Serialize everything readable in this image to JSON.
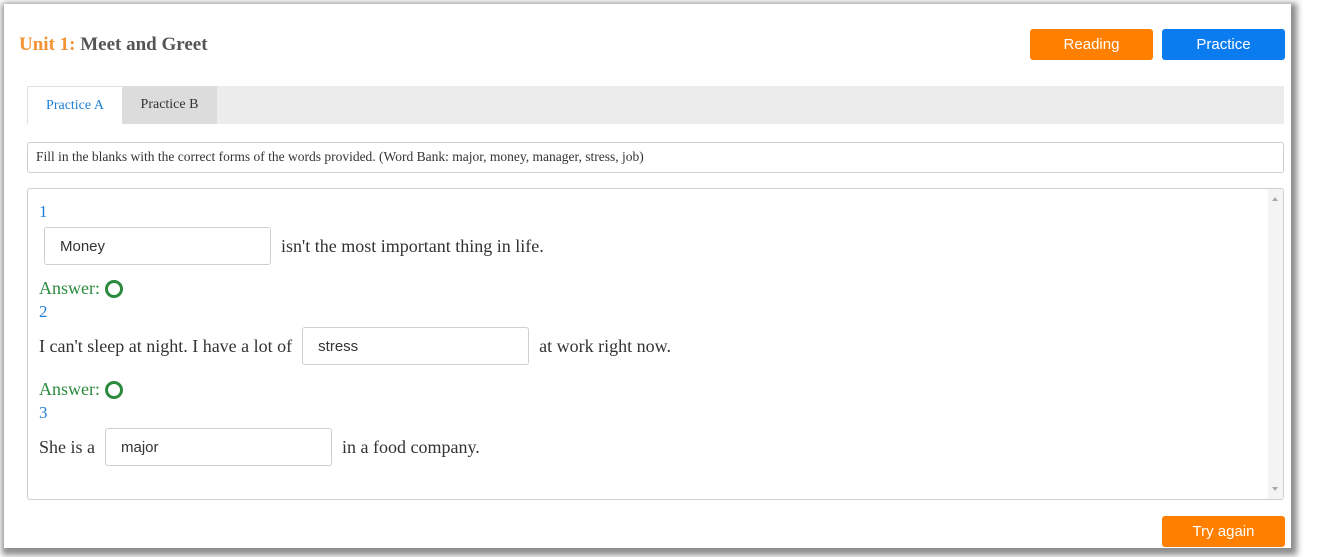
{
  "header": {
    "unit_label": "Unit 1:",
    "unit_title": "Meet and Greet",
    "reading_button": "Reading",
    "practice_button": "Practice"
  },
  "tabs": [
    {
      "label": "Practice A",
      "active": true
    },
    {
      "label": "Practice B",
      "active": false
    }
  ],
  "instructions": "Fill in the blanks with the correct forms of the words provided. (Word Bank: major, money, manager, stress, job)",
  "questions": [
    {
      "number": "1",
      "before": "",
      "value": "Money",
      "after": "isn't the most important thing in life.",
      "answer_label": "Answer:",
      "answer_mark": "correct-circle"
    },
    {
      "number": "2",
      "before": "I can't sleep at night. I have a lot of",
      "value": "stress",
      "after": "at work right now.",
      "answer_label": "Answer:",
      "answer_mark": "correct-circle"
    },
    {
      "number": "3",
      "before": "She is a",
      "value": "major",
      "after": "in a food company."
    }
  ],
  "footer": {
    "try_again_button": "Try again"
  },
  "colors": {
    "accent_orange": "#ff7f00",
    "accent_blue": "#0a7cf0",
    "correct_green": "#2b8a3e"
  }
}
